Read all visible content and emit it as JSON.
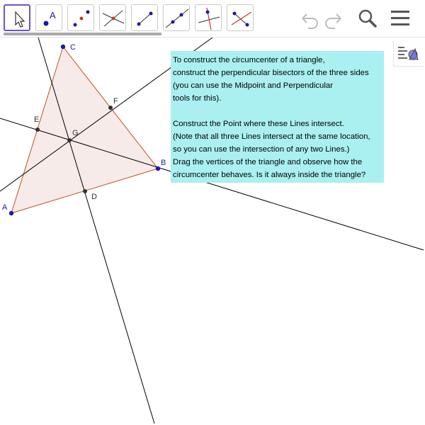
{
  "toolbar": {
    "tools": [
      {
        "name": "move-tool",
        "selected": true
      },
      {
        "name": "point-tool",
        "glyph": "A"
      },
      {
        "name": "midpoint-tool"
      },
      {
        "name": "intersect-tool"
      },
      {
        "name": "segment-tool"
      },
      {
        "name": "line-tool"
      },
      {
        "name": "perpendicular-line-tool"
      },
      {
        "name": "perpendicular-bisector-tool"
      }
    ],
    "undo_icon": "undo-icon",
    "redo_icon": "redo-icon",
    "search_icon": "search-icon",
    "menu_icon": "menu-icon"
  },
  "side_panel_toggle_icon": "algebra-view-toggle-icon",
  "points": {
    "A": {
      "label": "A"
    },
    "B": {
      "label": "B"
    },
    "C": {
      "label": "C"
    },
    "D": {
      "label": "D"
    },
    "E": {
      "label": "E"
    },
    "F": {
      "label": "F"
    },
    "G": {
      "label": "G"
    }
  },
  "colors": {
    "free_point": "#1a1aa6",
    "dependent_point": "#333333",
    "triangle_fill": "#f5e8e4",
    "triangle_edge": "#c05020",
    "label": "#1a1aa6",
    "info_bg": "#aaf0f0",
    "tool_selected_border": "#6557d2"
  },
  "info_text": {
    "line1": "To construct the circumcenter of a triangle,",
    "line2": "construct the perpendicular bisectors of the three sides",
    "line3": "(you can use the Midpoint and Perpendicular",
    "line4": "tools for this).",
    "line5": "Construct the Point where these Lines intersect.",
    "line6": "(Note that all three Lines intersect at the same location,",
    "line7": "so you can use the intersection of any two Lines.)",
    "line8": "Drag the vertices of the triangle and observe how the",
    "line9": "circumcenter behaves. Is it always inside the triangle?"
  }
}
